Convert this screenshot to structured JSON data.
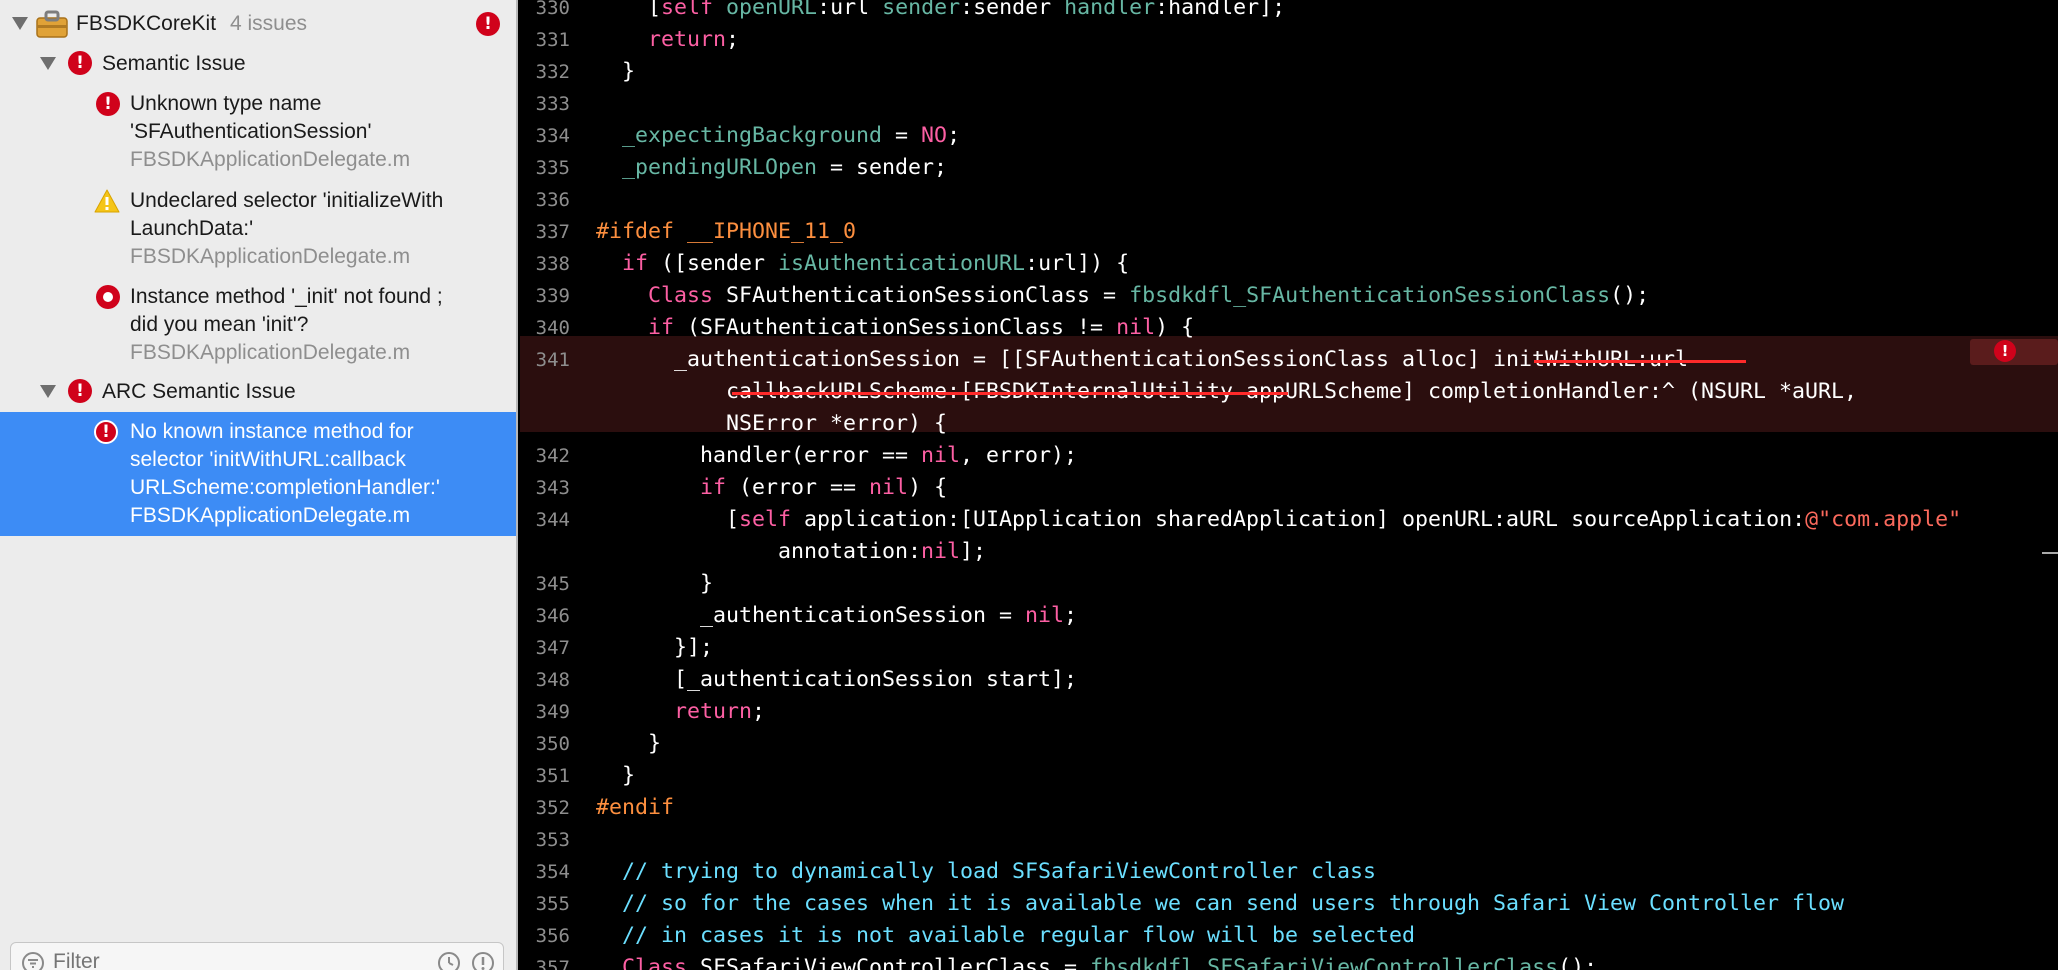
{
  "navigator": {
    "project": {
      "name": "FBSDKCoreKit",
      "count": "4 issues"
    },
    "groups": [
      {
        "title": "Semantic Issue",
        "issues": [
          {
            "severity": "error",
            "lines": [
              "Unknown type name",
              "'SFAuthenticationSession'"
            ],
            "file": "FBSDKApplicationDelegate.m"
          },
          {
            "severity": "warning",
            "lines": [
              "Undeclared selector 'initializeWith",
              "LaunchData:'"
            ],
            "file": "FBSDKApplicationDelegate.m"
          },
          {
            "severity": "stop",
            "lines": [
              "Instance method '_init' not found ;",
              "did you mean 'init'?"
            ],
            "file": "FBSDKApplicationDelegate.m"
          }
        ]
      },
      {
        "title": "ARC Semantic Issue",
        "issues": [
          {
            "severity": "error",
            "selected": true,
            "lines": [
              "No known instance method for",
              "selector 'initWithURL:callback",
              "URLScheme:completionHandler:'"
            ],
            "file": "FBSDKApplicationDelegate.m"
          }
        ]
      }
    ],
    "filter_placeholder": "Filter"
  },
  "editor": {
    "colors": {
      "plain": "#ffffff",
      "keyword": "#fc5fa3",
      "project": "#67b7a4",
      "api": "#5dd8ff",
      "preproc": "#fd8f3f",
      "comment": "#6bdfff",
      "string": "#fc6a5d",
      "linenum": "#8e8e8e",
      "error": "#d0021b"
    },
    "lines": [
      {
        "n": "330",
        "toks": [
          [
            "    [",
            "p"
          ],
          [
            "self",
            "k"
          ],
          [
            " ",
            "p"
          ],
          [
            "openURL",
            "m"
          ],
          [
            ":url ",
            "p"
          ],
          [
            "sender",
            "m"
          ],
          [
            ":sender ",
            "p"
          ],
          [
            "handler",
            "m"
          ],
          [
            ":handler];",
            "p"
          ]
        ]
      },
      {
        "n": "331",
        "toks": [
          [
            "    ",
            "p"
          ],
          [
            "return",
            "k"
          ],
          [
            ";",
            "p"
          ]
        ]
      },
      {
        "n": "332",
        "toks": [
          [
            "  }",
            "p"
          ]
        ]
      },
      {
        "n": "333",
        "toks": []
      },
      {
        "n": "334",
        "toks": [
          [
            "  ",
            "p"
          ],
          [
            "_expectingBackground",
            "m"
          ],
          [
            " = ",
            "p"
          ],
          [
            "NO",
            "k"
          ],
          [
            ";",
            "p"
          ]
        ]
      },
      {
        "n": "335",
        "toks": [
          [
            "  ",
            "p"
          ],
          [
            "_pendingURLOpen",
            "m"
          ],
          [
            " = sender;",
            "p"
          ]
        ]
      },
      {
        "n": "336",
        "toks": []
      },
      {
        "n": "337",
        "toks": [
          [
            "#ifdef __IPHONE_11_0",
            "pp"
          ]
        ]
      },
      {
        "n": "338",
        "toks": [
          [
            "  ",
            "p"
          ],
          [
            "if",
            "k"
          ],
          [
            " ([sender ",
            "p"
          ],
          [
            "isAuthenticationURL",
            "m"
          ],
          [
            ":url]) {",
            "p"
          ]
        ]
      },
      {
        "n": "339",
        "toks": [
          [
            "    ",
            "p"
          ],
          [
            "Class",
            "k"
          ],
          [
            " SFAuthenticationSessionClass = ",
            "p"
          ],
          [
            "fbsdkdfl_SFAuthenticationSessionClass",
            "m"
          ],
          [
            "();",
            "p"
          ]
        ]
      },
      {
        "n": "340",
        "toks": [
          [
            "    ",
            "p"
          ],
          [
            "if",
            "k"
          ],
          [
            " (SFAuthenticationSessionClass != ",
            "p"
          ],
          [
            "nil",
            "k"
          ],
          [
            ") {",
            "p"
          ]
        ]
      },
      {
        "n": "341",
        "toks": [
          [
            "      _authenticationSession = [[SFAuthenticationSessionClass alloc] initWithURL:url",
            "p"
          ]
        ]
      },
      {
        "n": "",
        "toks": [
          [
            "          callbackURLScheme:[FBSDKInternalUtility appURLScheme] completionHandler:^ (NSURL *aURL,",
            "p"
          ]
        ]
      },
      {
        "n": "",
        "toks": [
          [
            "          NSError *error) {",
            "p"
          ]
        ]
      },
      {
        "n": "342",
        "toks": [
          [
            "        handler(error == ",
            "p"
          ],
          [
            "nil",
            "k"
          ],
          [
            ", error);",
            "p"
          ]
        ]
      },
      {
        "n": "343",
        "toks": [
          [
            "        ",
            "p"
          ],
          [
            "if",
            "k"
          ],
          [
            " (error == ",
            "p"
          ],
          [
            "nil",
            "k"
          ],
          [
            ") {",
            "p"
          ]
        ]
      },
      {
        "n": "344",
        "toks": [
          [
            "          [",
            "p"
          ],
          [
            "self",
            "k"
          ],
          [
            " application:[UIApplication sharedApplication] openURL:aURL sourceApplication:",
            "p"
          ],
          [
            "@\"com.apple\"",
            "s"
          ]
        ]
      },
      {
        "n": "",
        "toks": [
          [
            "              annotation:",
            "p"
          ],
          [
            "nil",
            "k"
          ],
          [
            "];",
            "p"
          ]
        ]
      },
      {
        "n": "345",
        "toks": [
          [
            "        }",
            "p"
          ]
        ]
      },
      {
        "n": "346",
        "toks": [
          [
            "        _authenticationSession = ",
            "p"
          ],
          [
            "nil",
            "k"
          ],
          [
            ";",
            "p"
          ]
        ]
      },
      {
        "n": "347",
        "toks": [
          [
            "      }];",
            "p"
          ]
        ]
      },
      {
        "n": "348",
        "toks": [
          [
            "      [_authenticationSession start];",
            "p"
          ]
        ]
      },
      {
        "n": "349",
        "toks": [
          [
            "      ",
            "p"
          ],
          [
            "return",
            "k"
          ],
          [
            ";",
            "p"
          ]
        ]
      },
      {
        "n": "350",
        "toks": [
          [
            "    }",
            "p"
          ]
        ]
      },
      {
        "n": "351",
        "toks": [
          [
            "  }",
            "p"
          ]
        ]
      },
      {
        "n": "352",
        "toks": [
          [
            "#endif",
            "pp"
          ]
        ]
      },
      {
        "n": "353",
        "toks": []
      },
      {
        "n": "354",
        "toks": [
          [
            "  // trying to dynamically load SFSafariViewController class",
            "c"
          ]
        ]
      },
      {
        "n": "355",
        "toks": [
          [
            "  // so for the cases when it is available we can send users through Safari View Controller flow",
            "c"
          ]
        ]
      },
      {
        "n": "356",
        "toks": [
          [
            "  // in cases it is not available regular flow will be selected",
            "c"
          ]
        ]
      },
      {
        "n": "357",
        "toks": [
          [
            "  ",
            "p"
          ],
          [
            "Class",
            "k"
          ],
          [
            " SFSafariViewControllerClass = ",
            "p"
          ],
          [
            "fbsdkdfl_SFSafariViewControllerClass",
            "m"
          ],
          [
            "();",
            "p"
          ]
        ]
      }
    ],
    "error_marker": "!"
  }
}
